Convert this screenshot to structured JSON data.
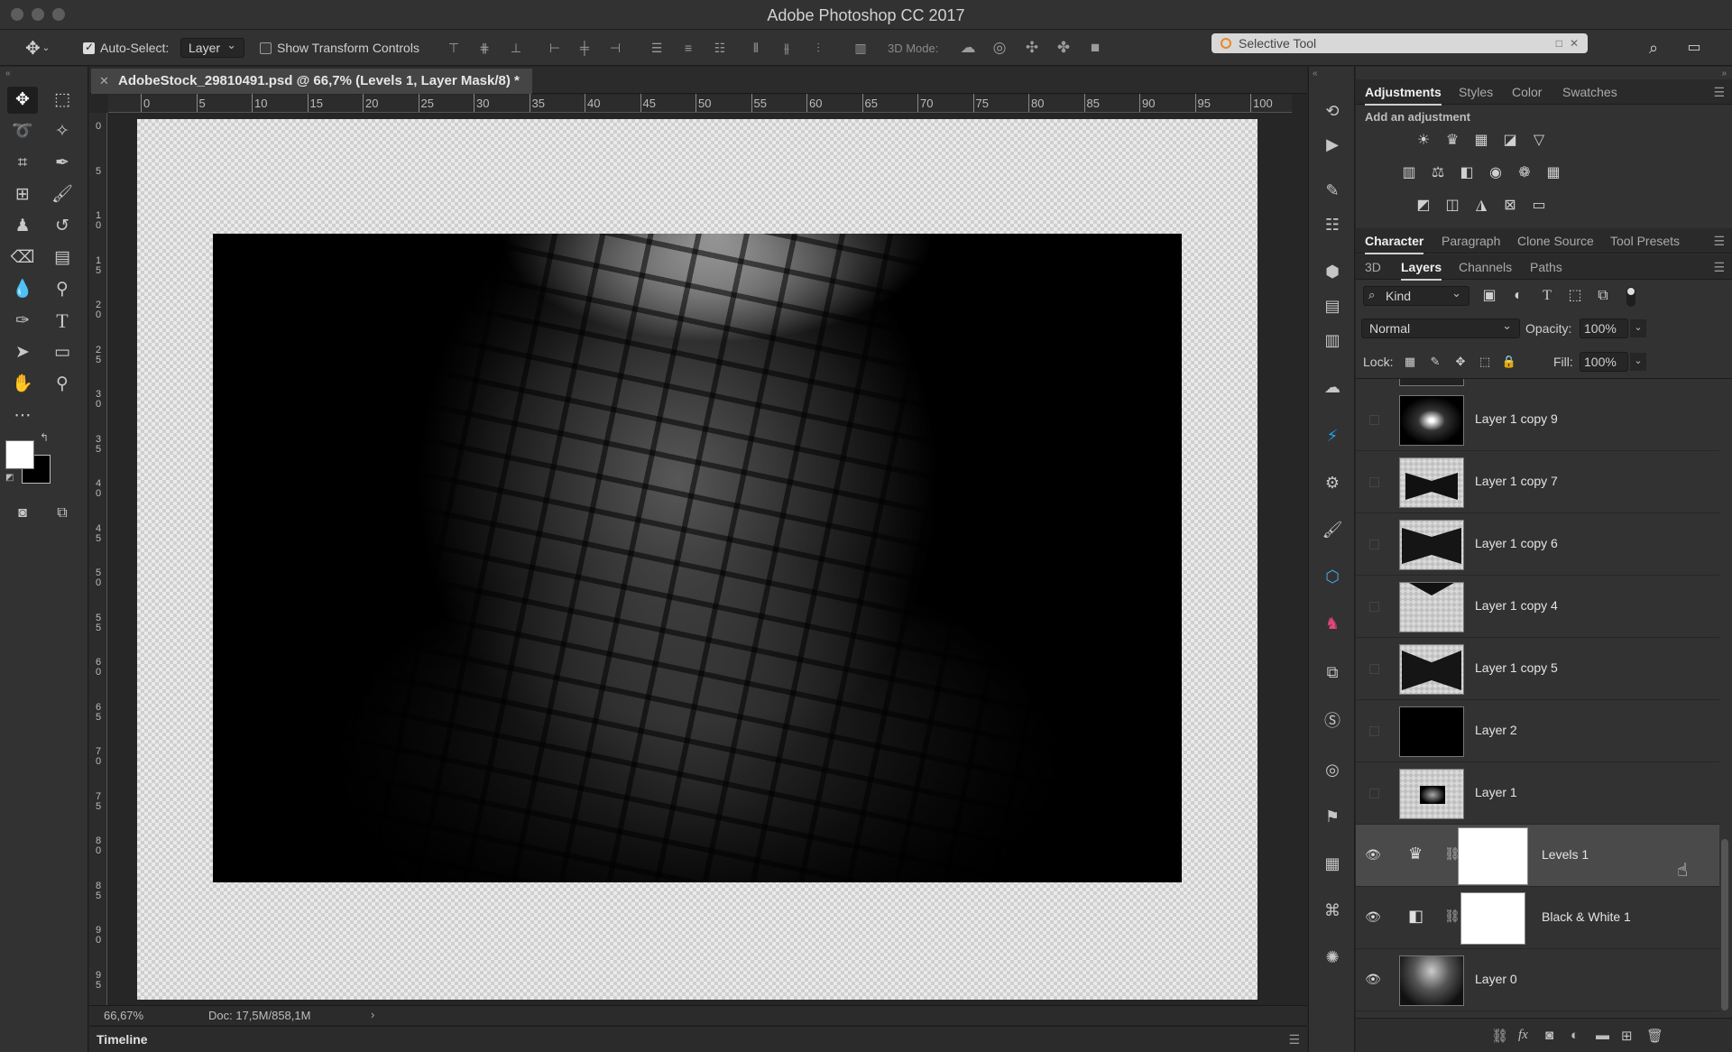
{
  "window": {
    "title": "Adobe Photoshop CC 2017"
  },
  "options_bar": {
    "auto_select_label": "Auto-Select:",
    "auto_select_value": "Layer",
    "show_transform_label": "Show Transform Controls",
    "mode_3d_label": "3D Mode:",
    "selective_tool_title": "Selective Tool"
  },
  "document": {
    "tab_title": "AdobeStock_29810491.psd @ 66,7% (Levels 1, Layer Mask/8) *",
    "ruler_h": [
      "0",
      "5",
      "10",
      "15",
      "20",
      "25",
      "30",
      "35",
      "40",
      "45",
      "50",
      "55",
      "60",
      "65",
      "70",
      "75",
      "80",
      "85",
      "90",
      "95",
      "100"
    ],
    "ruler_v": [
      "0",
      "5",
      "1\n0",
      "1\n5",
      "2\n0",
      "2\n5",
      "3\n0",
      "3\n5",
      "4\n0",
      "4\n5",
      "5\n0",
      "5\n5",
      "6\n0",
      "6\n5",
      "7\n0",
      "7\n5",
      "8\n0",
      "8\n5",
      "9\n0",
      "9\n5"
    ]
  },
  "status": {
    "zoom": "66,67%",
    "doc_size": "Doc: 17,5M/858,1M"
  },
  "timeline": {
    "label": "Timeline"
  },
  "adjustments_panel": {
    "tabs": [
      "Adjustments",
      "Styles",
      "Color",
      "Swatches"
    ],
    "active_tab": "Adjustments",
    "hint": "Add an adjustment"
  },
  "character_panel": {
    "tabs": [
      "Character",
      "Paragraph",
      "Clone Source",
      "Tool Presets"
    ],
    "active_tab": "Character"
  },
  "layers_panel": {
    "tabs": [
      "3D",
      "Layers",
      "Channels",
      "Paths"
    ],
    "active_tab": "Layers",
    "filter_kind": "Kind",
    "blend_mode": "Normal",
    "opacity_label": "Opacity:",
    "opacity_value": "100%",
    "lock_label": "Lock:",
    "fill_label": "Fill:",
    "fill_value": "100%",
    "layers": [
      {
        "name": "Layer 1 copy 9",
        "visible": false
      },
      {
        "name": "Layer 1 copy 7",
        "visible": false
      },
      {
        "name": "Layer 1 copy 6",
        "visible": false
      },
      {
        "name": "Layer 1 copy 4",
        "visible": false
      },
      {
        "name": "Layer 1 copy 5",
        "visible": false
      },
      {
        "name": "Layer 2",
        "visible": false
      },
      {
        "name": "Layer 1",
        "visible": false
      },
      {
        "name": "Levels 1",
        "visible": true,
        "selected": true
      },
      {
        "name": "Black & White 1",
        "visible": true
      },
      {
        "name": "Layer 0",
        "visible": true
      }
    ]
  }
}
